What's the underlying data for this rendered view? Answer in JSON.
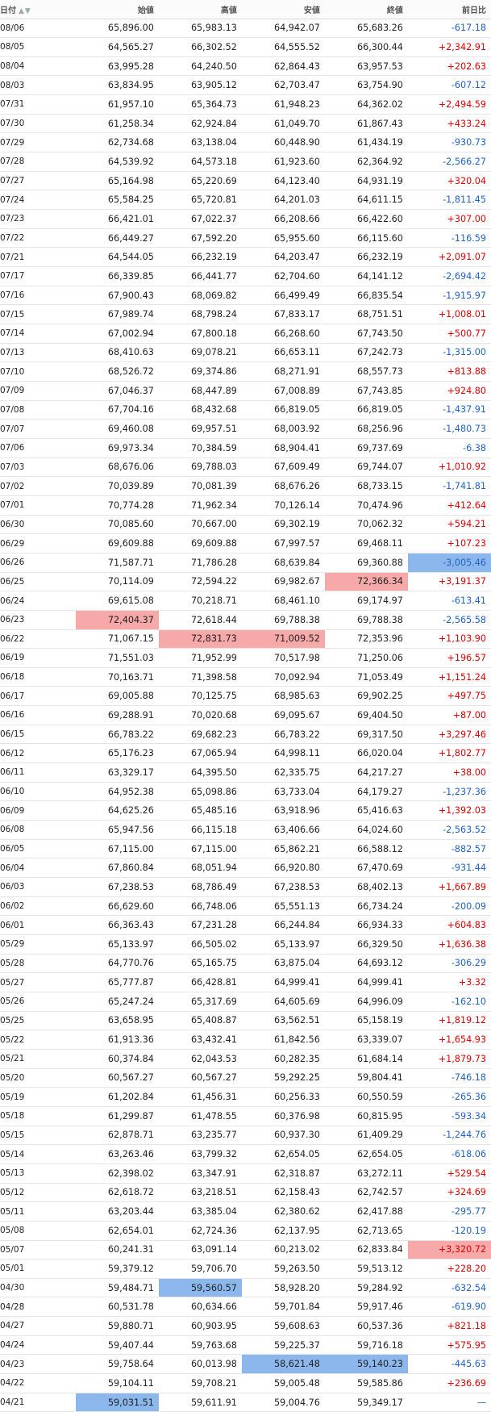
{
  "header": {
    "date": "日付",
    "open": "始値",
    "high": "高値",
    "low": "安値",
    "close": "終値",
    "change": "前日比",
    "sort_icons": "▲▼"
  },
  "colors": {
    "up": "#e00000",
    "down": "#1f62c6",
    "highlight_red": "#f7a8a8",
    "highlight_blue": "#8cb7ec"
  },
  "rows": [
    [
      "08/06",
      "65,896.00",
      "65,983.13",
      "64,942.07",
      "65,683.26",
      "-617.18"
    ],
    [
      "08/05",
      "64,565.27",
      "66,302.52",
      "64,555.52",
      "66,300.44",
      "+2,342.91"
    ],
    [
      "08/04",
      "63,995.28",
      "64,240.50",
      "62,864.43",
      "63,957.53",
      "+202.63"
    ],
    [
      "08/03",
      "63,834.95",
      "63,905.12",
      "62,703.47",
      "63,754.90",
      "-607.12"
    ],
    [
      "07/31",
      "61,957.10",
      "65,364.73",
      "61,948.23",
      "64,362.02",
      "+2,494.59"
    ],
    [
      "07/30",
      "61,258.34",
      "62,924.84",
      "61,049.70",
      "61,867.43",
      "+433.24"
    ],
    [
      "07/29",
      "62,734.68",
      "63,138.04",
      "60,448.90",
      "61,434.19",
      "-930.73"
    ],
    [
      "07/28",
      "64,539.92",
      "64,573.18",
      "61,923.60",
      "62,364.92",
      "-2,566.27"
    ],
    [
      "07/27",
      "65,164.98",
      "65,220.69",
      "64,123.40",
      "64,931.19",
      "+320.04"
    ],
    [
      "07/24",
      "65,584.25",
      "65,720.81",
      "64,201.03",
      "64,611.15",
      "-1,811.45"
    ],
    [
      "07/23",
      "66,421.01",
      "67,022.37",
      "66,208.66",
      "66,422.60",
      "+307.00"
    ],
    [
      "07/22",
      "66,449.27",
      "67,592.20",
      "65,955.60",
      "66,115.60",
      "-116.59"
    ],
    [
      "07/21",
      "64,544.05",
      "66,232.19",
      "64,203.47",
      "66,232.19",
      "+2,091.07"
    ],
    [
      "07/17",
      "66,339.85",
      "66,441.77",
      "62,704.60",
      "64,141.12",
      "-2,694.42"
    ],
    [
      "07/16",
      "67,900.43",
      "68,069.82",
      "66,499.49",
      "66,835.54",
      "-1,915.97"
    ],
    [
      "07/15",
      "67,989.74",
      "68,798.24",
      "67,833.17",
      "68,751.51",
      "+1,008.01"
    ],
    [
      "07/14",
      "67,002.94",
      "67,800.18",
      "66,268.60",
      "67,743.50",
      "+500.77"
    ],
    [
      "07/13",
      "68,410.63",
      "69,078.21",
      "66,653.11",
      "67,242.73",
      "-1,315.00"
    ],
    [
      "07/10",
      "68,526.72",
      "69,374.86",
      "68,271.91",
      "68,557.73",
      "+813.88"
    ],
    [
      "07/09",
      "67,046.37",
      "68,447.89",
      "67,008.89",
      "67,743.85",
      "+924.80"
    ],
    [
      "07/08",
      "67,704.16",
      "68,432.68",
      "66,819.05",
      "66,819.05",
      "-1,437.91"
    ],
    [
      "07/07",
      "69,460.08",
      "69,957.51",
      "68,003.92",
      "68,256.96",
      "-1,480.73"
    ],
    [
      "07/06",
      "69,973.34",
      "70,384.59",
      "68,904.41",
      "69,737.69",
      "-6.38"
    ],
    [
      "07/03",
      "68,676.06",
      "69,788.03",
      "67,609.49",
      "69,744.07",
      "+1,010.92"
    ],
    [
      "07/02",
      "70,039.89",
      "70,081.39",
      "68,676.26",
      "68,733.15",
      "-1,741.81"
    ],
    [
      "07/01",
      "70,774.28",
      "71,962.34",
      "70,126.14",
      "70,474.96",
      "+412.64"
    ],
    [
      "06/30",
      "70,085.60",
      "70,667.00",
      "69,302.19",
      "70,062.32",
      "+594.21"
    ],
    [
      "06/29",
      "69,609.88",
      "69,609.88",
      "67,997.57",
      "69,468.11",
      "+107.23"
    ],
    [
      "06/26",
      "71,587.71",
      "71,786.28",
      "68,639.84",
      "69,360.88",
      "-3,005.46"
    ],
    [
      "06/25",
      "70,114.09",
      "72,594.22",
      "69,982.67",
      "72,366.34",
      "+3,191.37"
    ],
    [
      "06/24",
      "69,615.08",
      "70,218.71",
      "68,461.10",
      "69,174.97",
      "-613.41"
    ],
    [
      "06/23",
      "72,404.37",
      "72,618.44",
      "69,788.38",
      "69,788.38",
      "-2,565.58"
    ],
    [
      "06/22",
      "71,067.15",
      "72,831.73",
      "71,009.52",
      "72,353.96",
      "+1,103.90"
    ],
    [
      "06/19",
      "71,551.03",
      "71,952.99",
      "70,517.98",
      "71,250.06",
      "+196.57"
    ],
    [
      "06/18",
      "70,163.71",
      "71,398.58",
      "70,092.94",
      "71,053.49",
      "+1,151.24"
    ],
    [
      "06/17",
      "69,005.88",
      "70,125.75",
      "68,985.63",
      "69,902.25",
      "+497.75"
    ],
    [
      "06/16",
      "69,288.91",
      "70,020.68",
      "69,095.67",
      "69,404.50",
      "+87.00"
    ],
    [
      "06/15",
      "66,783.22",
      "69,682.23",
      "66,783.22",
      "69,317.50",
      "+3,297.46"
    ],
    [
      "06/12",
      "65,176.23",
      "67,065.94",
      "64,998.11",
      "66,020.04",
      "+1,802.77"
    ],
    [
      "06/11",
      "63,329.17",
      "64,395.50",
      "62,335.75",
      "64,217.27",
      "+38.00"
    ],
    [
      "06/10",
      "64,952.38",
      "65,098.86",
      "63,733.04",
      "64,179.27",
      "-1,237.36"
    ],
    [
      "06/09",
      "64,625.26",
      "65,485.16",
      "63,918.96",
      "65,416.63",
      "+1,392.03"
    ],
    [
      "06/08",
      "65,947.56",
      "66,115.18",
      "63,406.66",
      "64,024.60",
      "-2,563.52"
    ],
    [
      "06/05",
      "67,115.00",
      "67,115.00",
      "65,862.21",
      "66,588.12",
      "-882.57"
    ],
    [
      "06/04",
      "67,860.84",
      "68,051.94",
      "66,920.80",
      "67,470.69",
      "-931.44"
    ],
    [
      "06/03",
      "67,238.53",
      "68,786.49",
      "67,238.53",
      "68,402.13",
      "+1,667.89"
    ],
    [
      "06/02",
      "66,629.60",
      "66,748.06",
      "65,551.13",
      "66,734.24",
      "-200.09"
    ],
    [
      "06/01",
      "66,363.43",
      "67,231.28",
      "66,244.84",
      "66,934.33",
      "+604.83"
    ],
    [
      "05/29",
      "65,133.97",
      "66,505.02",
      "65,133.97",
      "66,329.50",
      "+1,636.38"
    ],
    [
      "05/28",
      "64,770.76",
      "65,165.75",
      "63,875.04",
      "64,693.12",
      "-306.29"
    ],
    [
      "05/27",
      "65,777.87",
      "66,428.81",
      "64,999.41",
      "64,999.41",
      "+3.32"
    ],
    [
      "05/26",
      "65,247.24",
      "65,317.69",
      "64,605.69",
      "64,996.09",
      "-162.10"
    ],
    [
      "05/25",
      "63,658.95",
      "65,408.87",
      "63,562.51",
      "65,158.19",
      "+1,819.12"
    ],
    [
      "05/22",
      "61,913.36",
      "63,432.41",
      "61,842.56",
      "63,339.07",
      "+1,654.93"
    ],
    [
      "05/21",
      "60,374.84",
      "62,043.53",
      "60,282.35",
      "61,684.14",
      "+1,879.73"
    ],
    [
      "05/20",
      "60,567.27",
      "60,567.27",
      "59,292.25",
      "59,804.41",
      "-746.18"
    ],
    [
      "05/19",
      "61,202.84",
      "61,456.31",
      "60,256.33",
      "60,550.59",
      "-265.36"
    ],
    [
      "05/18",
      "61,299.87",
      "61,478.55",
      "60,376.98",
      "60,815.95",
      "-593.34"
    ],
    [
      "05/15",
      "62,878.71",
      "63,235.77",
      "60,937.30",
      "61,409.29",
      "-1,244.76"
    ],
    [
      "05/14",
      "63,263.46",
      "63,799.32",
      "62,654.05",
      "62,654.05",
      "-618.06"
    ],
    [
      "05/13",
      "62,398.02",
      "63,347.91",
      "62,318.87",
      "63,272.11",
      "+529.54"
    ],
    [
      "05/12",
      "62,618.72",
      "63,218.51",
      "62,158.43",
      "62,742.57",
      "+324.69"
    ],
    [
      "05/11",
      "63,203.44",
      "63,385.04",
      "62,380.62",
      "62,417.88",
      "-295.77"
    ],
    [
      "05/08",
      "62,654.01",
      "62,724.36",
      "62,137.95",
      "62,713.65",
      "-120.19"
    ],
    [
      "05/07",
      "60,241.31",
      "63,091.14",
      "60,213.02",
      "62,833.84",
      "+3,320.72"
    ],
    [
      "05/01",
      "59,379.12",
      "59,706.70",
      "59,263.50",
      "59,513.12",
      "+228.20"
    ],
    [
      "04/30",
      "59,484.71",
      "59,560.57",
      "58,928.20",
      "59,284.92",
      "-632.54"
    ],
    [
      "04/28",
      "60,531.78",
      "60,634.66",
      "59,701.84",
      "59,917.46",
      "-619.90"
    ],
    [
      "04/27",
      "59,880.71",
      "60,903.95",
      "59,608.63",
      "60,537.36",
      "+821.18"
    ],
    [
      "04/24",
      "59,407.44",
      "59,763.68",
      "59,225.37",
      "59,716.18",
      "+575.95"
    ],
    [
      "04/23",
      "59,758.64",
      "60,013.98",
      "58,621.48",
      "59,140.23",
      "-445.63"
    ],
    [
      "04/22",
      "59,104.11",
      "59,708.21",
      "59,005.48",
      "59,585.86",
      "+236.69"
    ],
    [
      "04/21",
      "59,031.51",
      "59,611.91",
      "59,004.76",
      "59,349.17",
      "—"
    ]
  ],
  "highlights": [
    {
      "row": 28,
      "col": 5,
      "tone": "blue"
    },
    {
      "row": 29,
      "col": 4,
      "tone": "red"
    },
    {
      "row": 31,
      "col": 1,
      "tone": "red"
    },
    {
      "row": 32,
      "col": 2,
      "tone": "red"
    },
    {
      "row": 32,
      "col": 3,
      "tone": "red"
    },
    {
      "row": 64,
      "col": 5,
      "tone": "red"
    },
    {
      "row": 66,
      "col": 2,
      "tone": "blue"
    },
    {
      "row": 70,
      "col": 3,
      "tone": "blue"
    },
    {
      "row": 70,
      "col": 4,
      "tone": "blue"
    },
    {
      "row": 72,
      "col": 1,
      "tone": "blue"
    }
  ]
}
